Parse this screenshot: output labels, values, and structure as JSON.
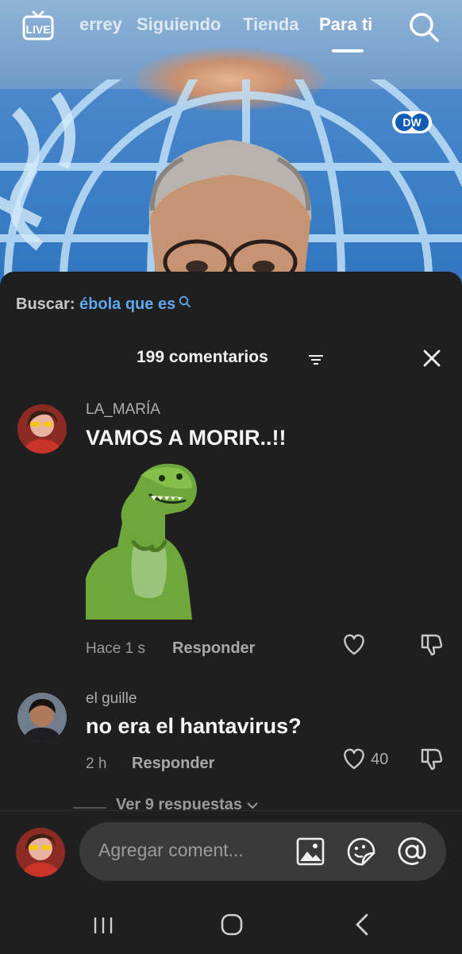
{
  "top_nav": {
    "live_label": "LIVE",
    "tabs": [
      {
        "label": "errey"
      },
      {
        "label": "Siguiendo"
      },
      {
        "label": "Tienda"
      },
      {
        "label": "Para ti"
      }
    ],
    "active_tab": "Para ti"
  },
  "video": {
    "logo_text": "DW"
  },
  "search_suggestion": {
    "label": "Buscar:",
    "query": "ébola que es"
  },
  "comments_header": {
    "count_label": "199 comentarios"
  },
  "comments": [
    {
      "username": "LA_MARÍA",
      "text": "VAMOS A MORIR..!!",
      "time": "Hace 1 s",
      "reply_label": "Responder",
      "likes": ""
    },
    {
      "username": "el guille",
      "text": "no era el hantavirus?",
      "time": "2 h",
      "reply_label": "Responder",
      "likes": "40"
    }
  ],
  "view_replies_label": "Ver 9 respuestas",
  "comment_input": {
    "placeholder": "Agregar coment..."
  },
  "icons": {
    "top": [
      "live-tv-icon",
      "search-icon"
    ],
    "comment": [
      "heart-icon",
      "dislike-icon"
    ],
    "input": [
      "image-icon",
      "sticker-icon",
      "mention-icon"
    ],
    "system": [
      "recents-icon",
      "home-icon",
      "back-icon"
    ]
  },
  "colors": {
    "sheet_bg": "#1f1f1f",
    "search_query": "#5fa8f0",
    "input_bg": "#3a3a3a"
  }
}
